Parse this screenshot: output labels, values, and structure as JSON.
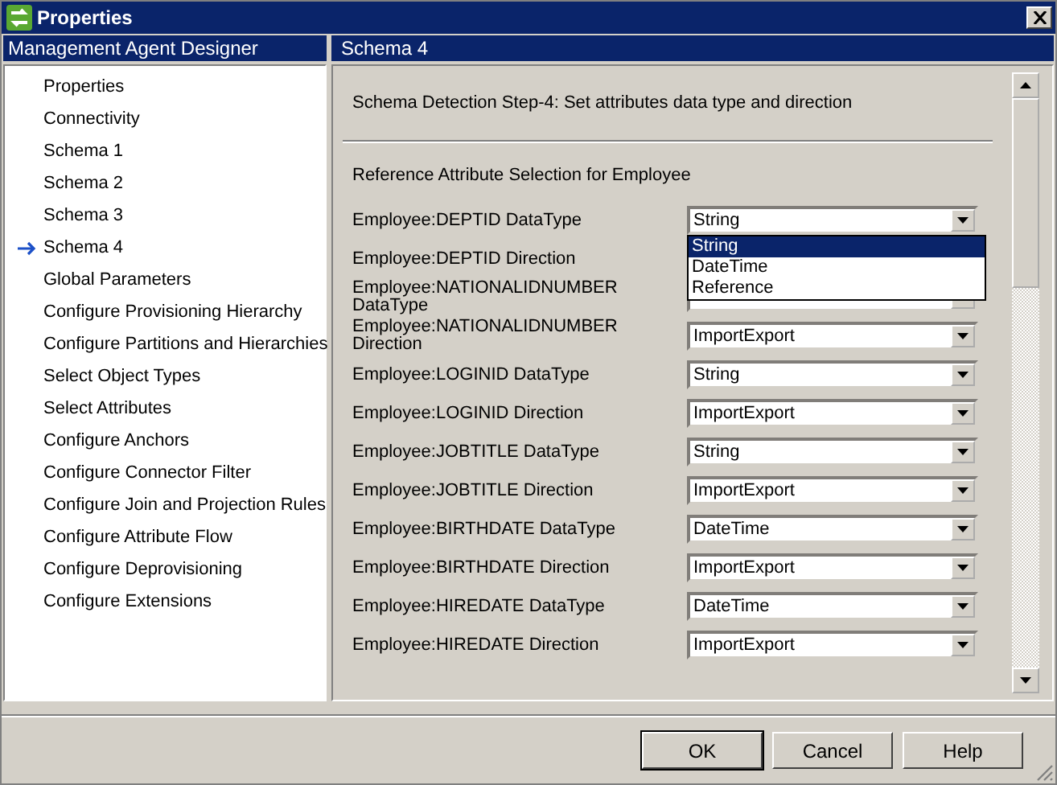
{
  "window": {
    "title": "Properties"
  },
  "sidebar": {
    "header": "Management Agent Designer",
    "items": [
      {
        "label": "Properties",
        "selected": false
      },
      {
        "label": "Connectivity",
        "selected": false
      },
      {
        "label": "Schema 1",
        "selected": false
      },
      {
        "label": "Schema 2",
        "selected": false
      },
      {
        "label": "Schema 3",
        "selected": false
      },
      {
        "label": "Schema 4",
        "selected": true
      },
      {
        "label": "Global Parameters",
        "selected": false
      },
      {
        "label": "Configure Provisioning Hierarchy",
        "selected": false
      },
      {
        "label": "Configure Partitions and Hierarchies",
        "selected": false
      },
      {
        "label": "Select Object Types",
        "selected": false
      },
      {
        "label": "Select Attributes",
        "selected": false
      },
      {
        "label": "Configure Anchors",
        "selected": false
      },
      {
        "label": "Configure Connector Filter",
        "selected": false
      },
      {
        "label": "Configure Join and Projection Rules",
        "selected": false
      },
      {
        "label": "Configure Attribute Flow",
        "selected": false
      },
      {
        "label": "Configure Deprovisioning",
        "selected": false
      },
      {
        "label": "Configure Extensions",
        "selected": false
      }
    ]
  },
  "panel": {
    "header": "Schema 4",
    "step": "Schema Detection Step-4: Set attributes data type and direction",
    "section": "Reference Attribute Selection for Employee",
    "rows": [
      {
        "label": "Employee:DEPTID DataType",
        "value": "String",
        "options": [
          {
            "label": "String",
            "selected": true
          },
          {
            "label": "DateTime",
            "selected": false
          },
          {
            "label": "Reference",
            "selected": false
          }
        ]
      },
      {
        "label": "Employee:DEPTID Direction"
      },
      {
        "label": "Employee:NATIONALIDNUMBER DataType"
      },
      {
        "label": "Employee:NATIONALIDNUMBER Direction",
        "value": "ImportExport"
      },
      {
        "label": "Employee:LOGINID DataType",
        "value": "String"
      },
      {
        "label": "Employee:LOGINID Direction",
        "value": "ImportExport"
      },
      {
        "label": "Employee:JOBTITLE DataType",
        "value": "String"
      },
      {
        "label": "Employee:JOBTITLE Direction",
        "value": "ImportExport"
      },
      {
        "label": "Employee:BIRTHDATE DataType",
        "value": "DateTime"
      },
      {
        "label": "Employee:BIRTHDATE Direction",
        "value": "ImportExport"
      },
      {
        "label": "Employee:HIREDATE DataType",
        "value": "DateTime"
      },
      {
        "label": "Employee:HIREDATE Direction",
        "value": "ImportExport"
      }
    ]
  },
  "buttons": [
    {
      "label": "OK",
      "default": true
    },
    {
      "label": "Cancel",
      "default": false
    },
    {
      "label": "Help",
      "default": false
    }
  ]
}
